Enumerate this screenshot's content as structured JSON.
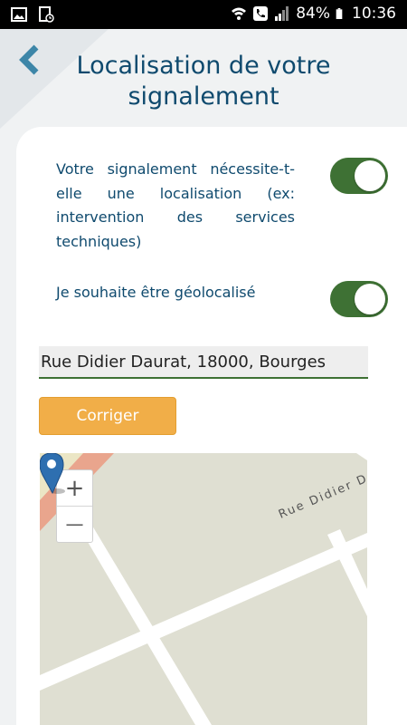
{
  "status_bar": {
    "battery": "84%",
    "time": "10:36",
    "icons": [
      "image-icon",
      "sim-notification-icon",
      "wifi-icon",
      "phone-icon",
      "signal-icon",
      "battery-icon"
    ]
  },
  "header": {
    "back_icon": "chevron-left-icon",
    "title": "Localisation de votre signalement"
  },
  "options": [
    {
      "label": "Votre signalement nécessite-t-elle une localisation (ex: intervention des services techniques)",
      "enabled": true
    },
    {
      "label": "Je souhaite être géolocalisé",
      "enabled": true
    }
  ],
  "address": {
    "value": "Rue Didier Daurat, 18000, Bourges"
  },
  "actions": {
    "correct_label": "Corriger"
  },
  "map": {
    "street_label": "Rue Didier D",
    "zoom_in_label": "+",
    "zoom_out_label": "—"
  },
  "colors": {
    "title": "#0f4a6e",
    "toggle_on": "#3e7134",
    "button": "#f1ae48",
    "map_bg": "#dfdfd2",
    "pin": "#2e6fb0"
  }
}
